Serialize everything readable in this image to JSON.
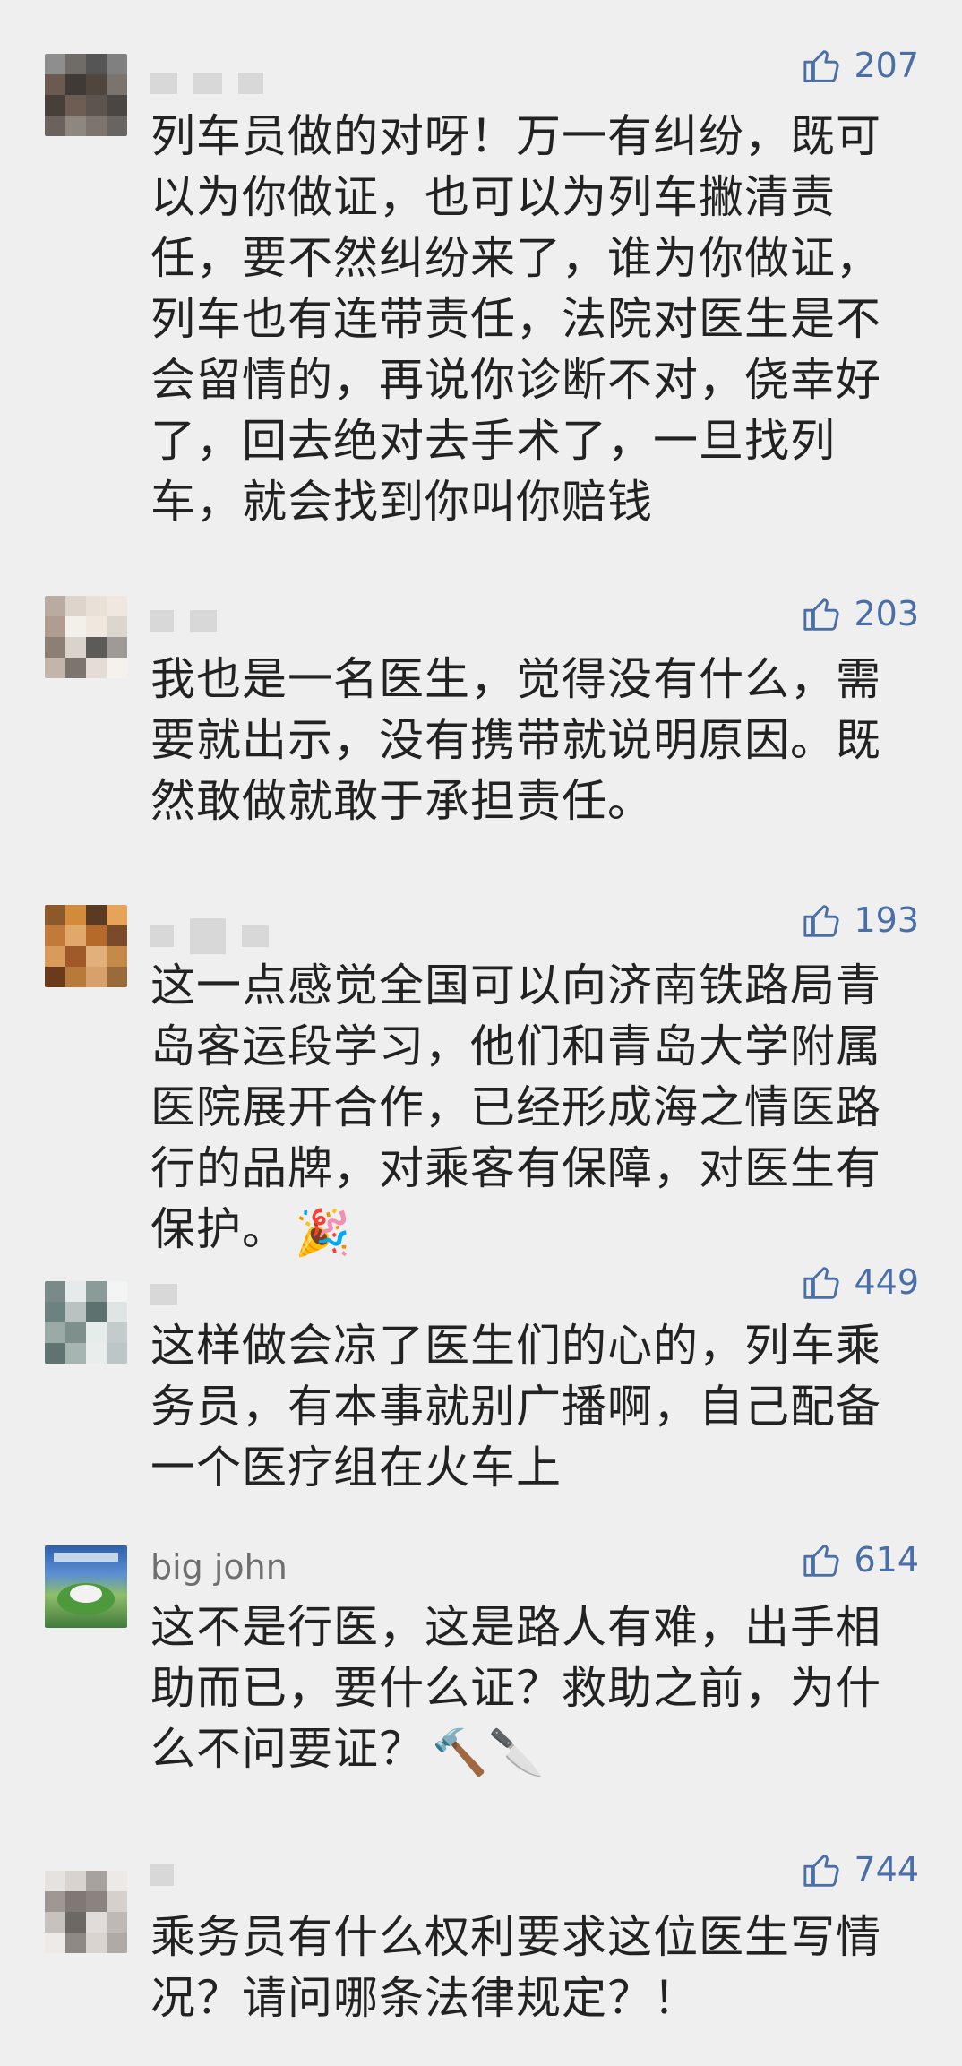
{
  "comments": [
    {
      "username": "",
      "likes": "207",
      "text": "列车员做的对呀！万一有纠纷，既可以为你做证，也可以为列车撇清责任，要不然纠纷来了，谁为你做证，列车也有连带责任，法院对医生是不会留情的，再说你诊断不对，侥幸好了，回去绝对去手术了，一旦找列车，就会找到你叫你赔钱",
      "avatar_colors": [
        "#8e8e8e",
        "#6f6b67",
        "#555",
        "#808080",
        "#6a5a4f",
        "#3f3a36",
        "#51463e",
        "#7b736d",
        "#473f3a",
        "#6e5d52",
        "#5c544e",
        "#4a4643",
        "#6b625d",
        "#8d877f",
        "#7d746d",
        "#686462"
      ]
    },
    {
      "username": "",
      "likes": "203",
      "text": "我也是一名医生，觉得没有什么，需要就出示，没有携带就说明原因。既然敢做就敢于承担责任。",
      "avatar_colors": [
        "#b9aaa2",
        "#ded4cc",
        "#e9e0d8",
        "#f0e8e0",
        "#b19d90",
        "#f3efe9",
        "#f0e7df",
        "#ddd6cf",
        "#8e7f75",
        "#d9d3cc",
        "#5c5b58",
        "#a09a96",
        "#c4b5aa",
        "#7c746d",
        "#e4ddd6",
        "#f5f1ec"
      ]
    },
    {
      "username": "",
      "likes": "193",
      "text": "这一点感觉全国可以向济南铁路局青岛客运段学习，他们和青岛大学附属医院展开合作，已经形成海之情医路行的品牌，对乘客有保障，对医生有保护。",
      "emoji": "🎉",
      "avatar_colors": [
        "#8c5a2a",
        "#d48a3b",
        "#5a3a22",
        "#e8a35a",
        "#c27a3b",
        "#e0a86a",
        "#b56a2a",
        "#7a4a2a",
        "#d89b5a",
        "#a05a2a",
        "#e2b07a",
        "#c48a4a",
        "#6a3a1a",
        "#b87a3a",
        "#d8a06a",
        "#9a6a3a"
      ]
    },
    {
      "username": "",
      "likes": "449",
      "text": "这样做会凉了医生们的心的，列车乘务员，有本事就别广播啊，自己配备一个医疗组在火车上",
      "avatar_colors": [
        "#7a8a88",
        "#e5ebea",
        "#8a9b98",
        "#f3f5f4",
        "#6c8280",
        "#b8c3c1",
        "#5c726f",
        "#dfe5e4",
        "#9aaaa7",
        "#7e8f8c",
        "#e6ecea",
        "#c3ccca",
        "#5f7370",
        "#a7b5b2",
        "#e9eeed",
        "#bcc6c4"
      ]
    },
    {
      "username": "big john",
      "likes": "614",
      "text": "这不是行医，这是路人有难，出手相助而已，要什么证？救助之前，为什么不问要证？",
      "emoji": "🔨🔪"
    },
    {
      "username": "",
      "likes": "744",
      "text": "乘务员有什么权利要求这位医生写情况？请问哪条法律规定？！",
      "avatar_colors": [
        "#e6e2df",
        "#d8d3cf",
        "#a8a29e",
        "#ece9e6",
        "#9e9793",
        "#7f7874",
        "#8a837f",
        "#d5d0cc",
        "#c8c2be",
        "#6e6864",
        "#e0dcd9",
        "#bfb9b5",
        "#eeeae7",
        "#8f8985",
        "#d9d4d0",
        "#b0aaa6"
      ]
    }
  ],
  "colors": {
    "background": "#efefef",
    "like": "#4a6ea8",
    "name": "#6f6f6f"
  }
}
